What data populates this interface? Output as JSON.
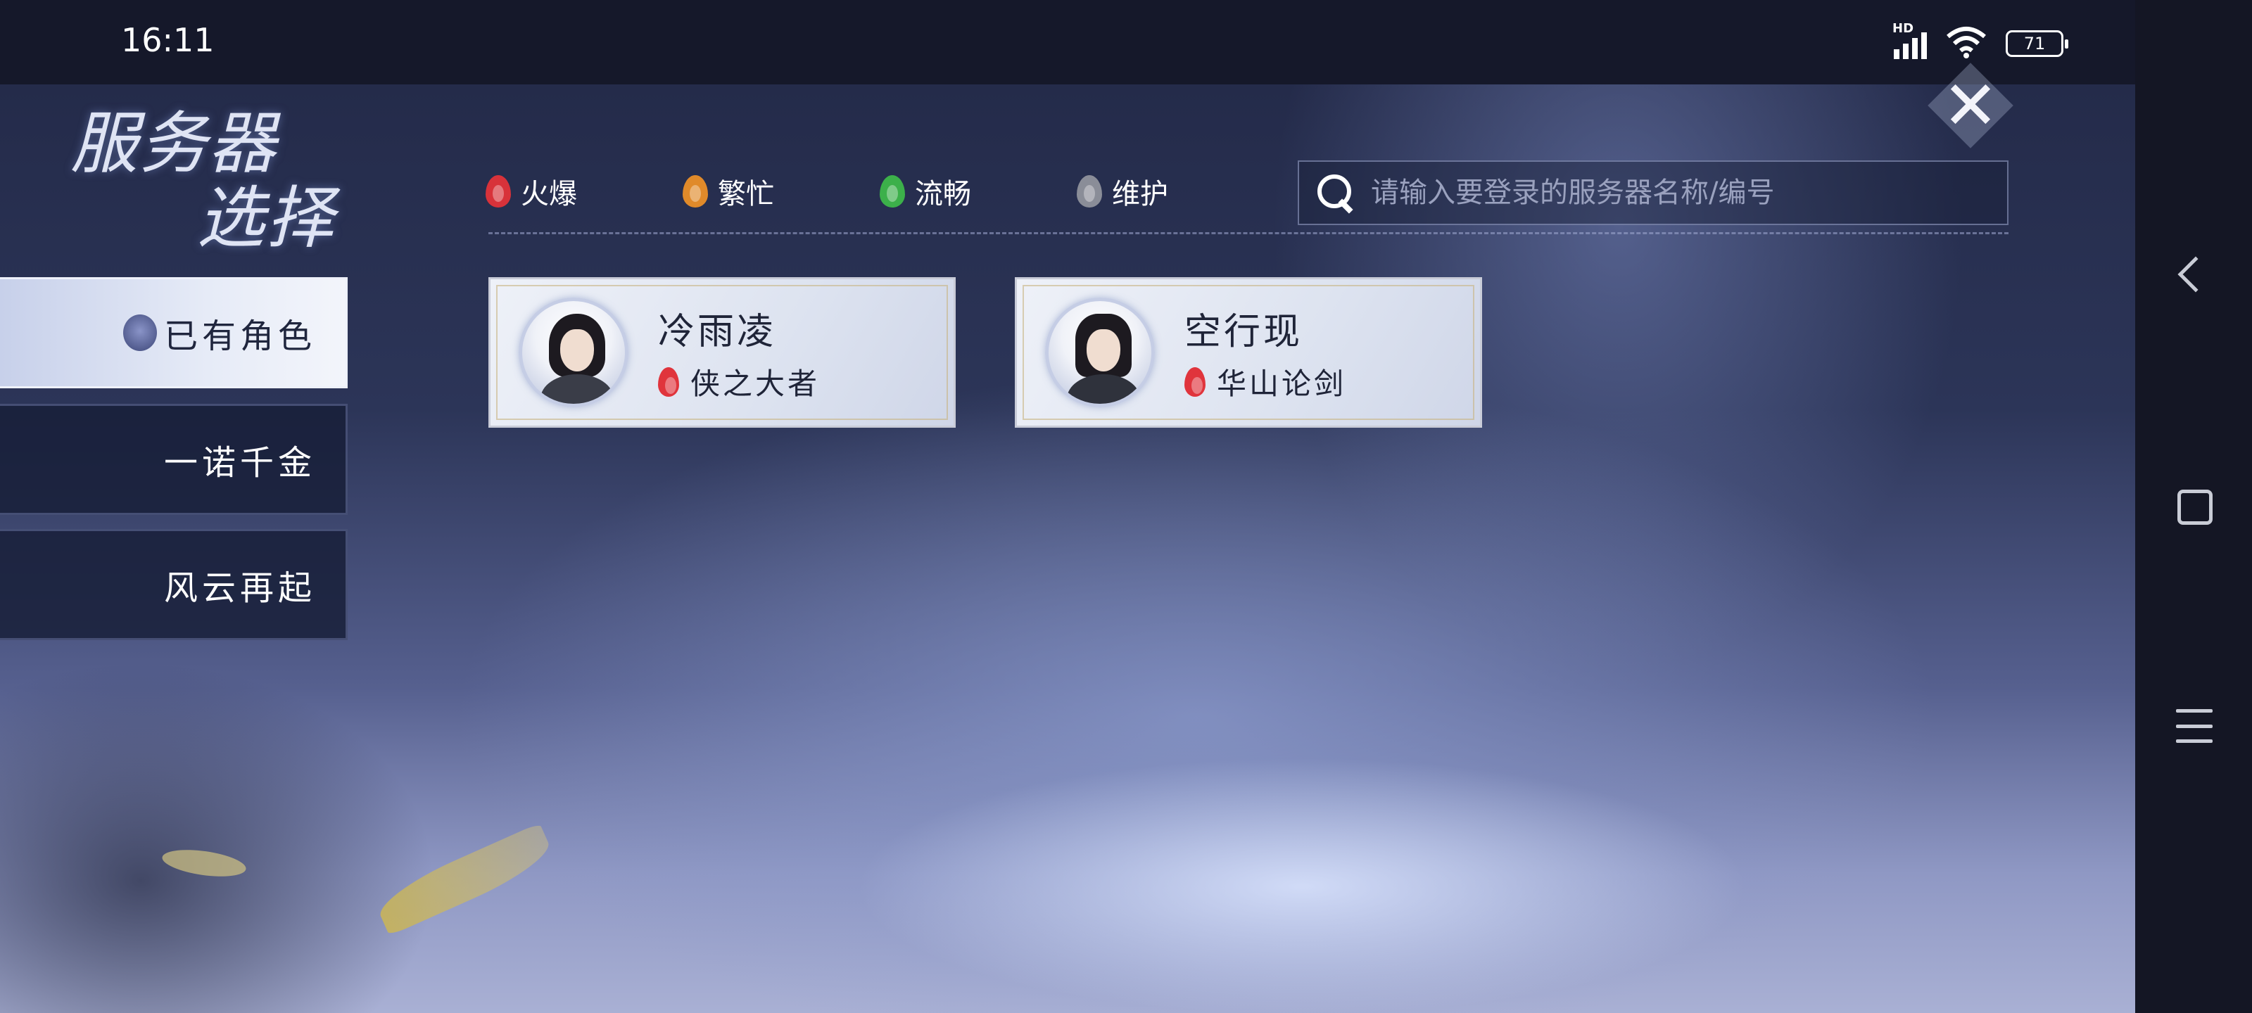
{
  "status_bar": {
    "time": "16:11",
    "network": "HD",
    "battery_level": "71"
  },
  "page_title": {
    "line1": "服务器",
    "line2": "选择"
  },
  "close_icon": "✕",
  "legend": [
    {
      "label": "火爆",
      "color": "#d8323a"
    },
    {
      "label": "繁忙",
      "color": "#e08a2a"
    },
    {
      "label": "流畅",
      "color": "#3cb04a"
    },
    {
      "label": "维护",
      "color": "#8a8d98"
    }
  ],
  "search": {
    "placeholder": "请输入要登录的服务器名称/编号"
  },
  "sidebar": {
    "tabs": [
      {
        "label": "已有角色",
        "active": true
      },
      {
        "label": "一诺千金",
        "active": false
      },
      {
        "label": "风云再起",
        "active": false
      }
    ]
  },
  "servers": [
    {
      "character": "冷雨凌",
      "server": "侠之大者",
      "status_color": "#e0343c"
    },
    {
      "character": "空行现",
      "server": "华山论剑",
      "status_color": "#e0343c"
    }
  ],
  "colors": {
    "accent_active_tab": "#e6ebf7",
    "panel_dark": "#181e38"
  }
}
